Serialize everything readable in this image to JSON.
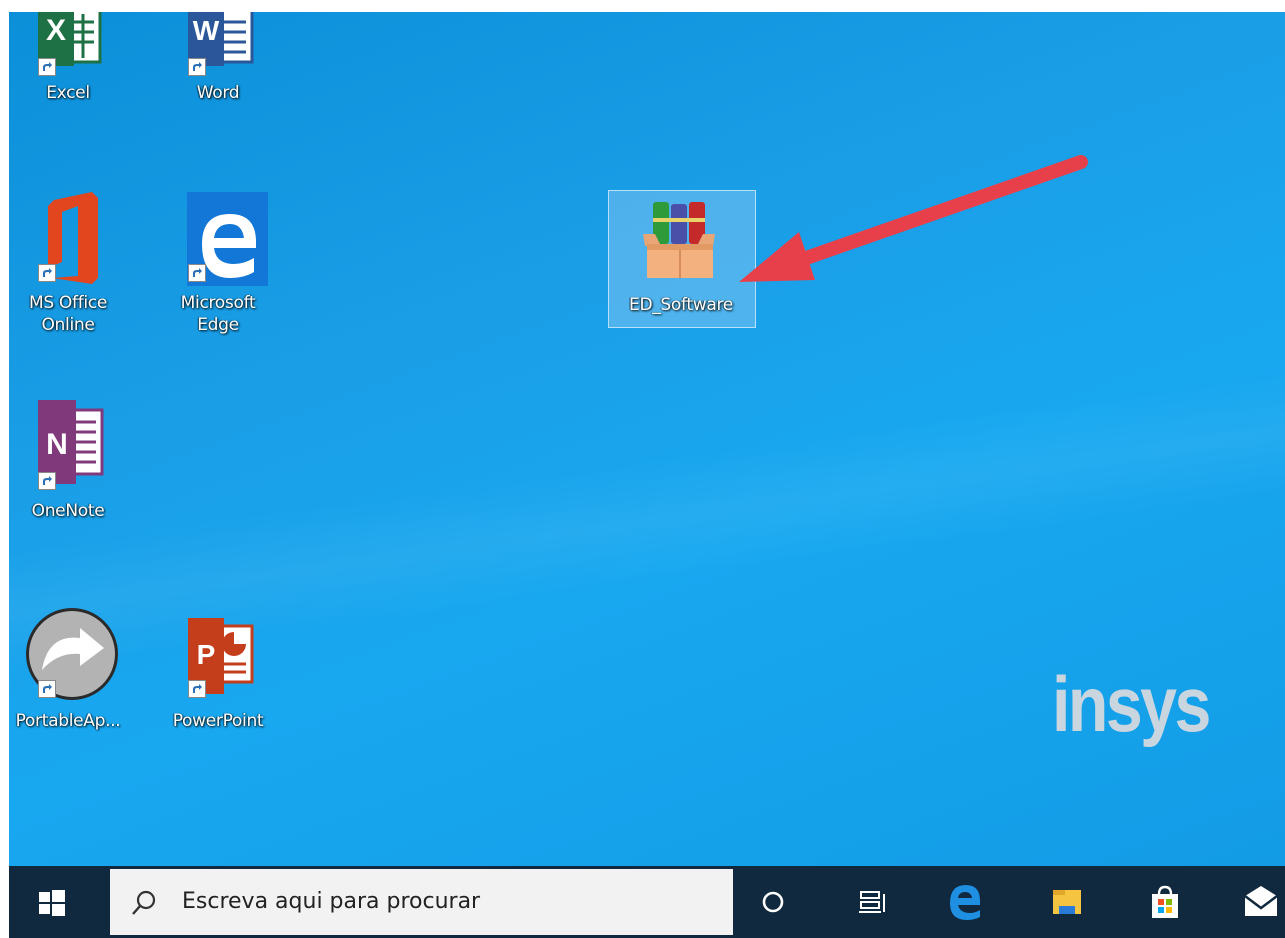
{
  "desktop": {
    "icons": [
      {
        "label": "Excel"
      },
      {
        "label": "Word"
      },
      {
        "label": "MS Office Online"
      },
      {
        "label": "Microsoft Edge"
      },
      {
        "label": "ED_Software"
      },
      {
        "label": "OneNote"
      },
      {
        "label": "PortableAp..."
      },
      {
        "label": "PowerPoint"
      }
    ],
    "wallpaper_brand": "insys",
    "colors": {
      "wallpaper": "#139be6",
      "taskbar": "#10293f",
      "arrow": "#e8404a"
    }
  },
  "taskbar": {
    "search_placeholder": "Escreva aqui para procurar",
    "icons": [
      "windows-start-icon",
      "search-icon",
      "cortana-icon",
      "task-view-icon",
      "edge-icon",
      "file-explorer-icon",
      "store-icon",
      "mail-icon"
    ]
  }
}
